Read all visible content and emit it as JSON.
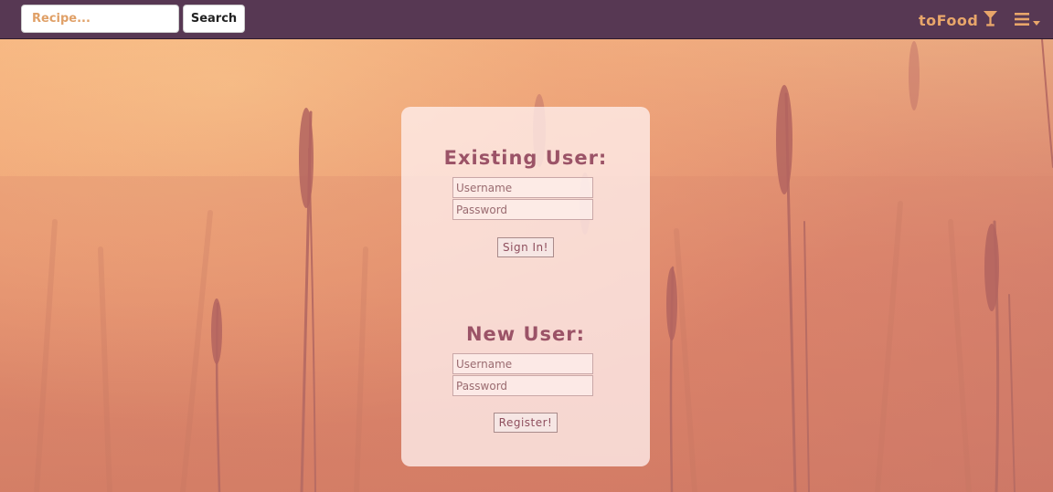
{
  "search": {
    "placeholder": "Recipe...",
    "button_label": "Search"
  },
  "brand": {
    "name": "toFood",
    "icon": "cocktail-glass-icon"
  },
  "menu": {
    "icon": "hamburger-menu-icon"
  },
  "existing_user": {
    "title": "Existing User:",
    "username_placeholder": "Username",
    "password_placeholder": "Password",
    "submit_label": "Sign In!"
  },
  "new_user": {
    "title": "New User:",
    "username_placeholder": "Username",
    "password_placeholder": "Password",
    "submit_label": "Register!"
  },
  "colors": {
    "navbar": "#573853",
    "brand": "#e8a66a",
    "title": "#9b5367",
    "search_text": "#e0a067"
  }
}
